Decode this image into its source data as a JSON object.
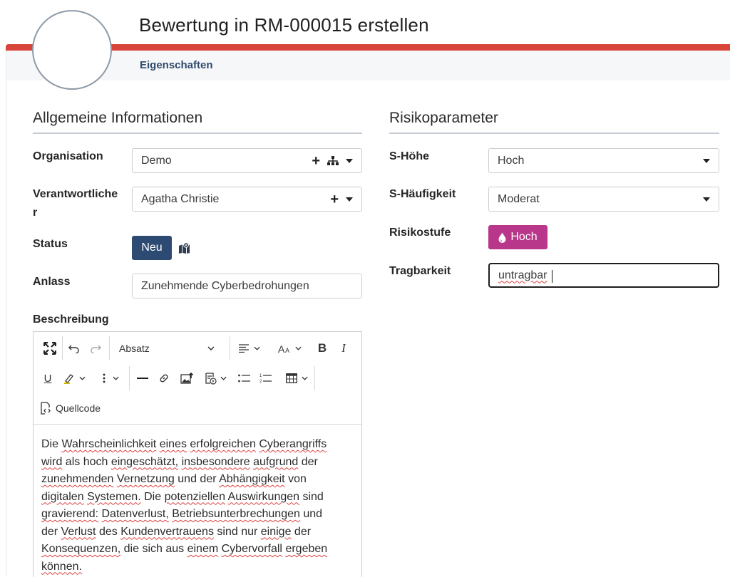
{
  "header": {
    "title": "Bewertung in RM-000015 erstellen",
    "tab_active": "Eigenschaften",
    "accent_color": "#d9443a"
  },
  "left": {
    "section_title": "Allgemeine Informationen",
    "organisation": {
      "label": "Organisation",
      "value": "Demo",
      "icons": [
        "plus-icon",
        "sitemap-icon",
        "caret-down-icon"
      ]
    },
    "verantwortlicher": {
      "label_line1": "Verantwortliche",
      "label_line2": "r",
      "value": "Agatha Christie",
      "icons": [
        "plus-icon",
        "caret-down-icon"
      ]
    },
    "status": {
      "label": "Status",
      "badge": "Neu",
      "badge_color": "#2d4b72",
      "icon": "map-icon"
    },
    "anlass": {
      "label": "Anlass",
      "value": "Zunehmende Cyberbedrohungen"
    },
    "beschreibung": {
      "label": "Beschreibung",
      "toolbar": {
        "heading_select": "Absatz",
        "source_label": "Quellcode",
        "icons": [
          "fullscreen-icon",
          "undo-icon",
          "redo-icon",
          "align-icon",
          "font-size-icon",
          "bold-icon",
          "italic-icon",
          "underline-icon",
          "highlight-icon",
          "more-icon",
          "horizontal-line-icon",
          "link-icon",
          "image-upload-icon",
          "insert-template-icon",
          "bulleted-list-icon",
          "numbered-list-icon",
          "table-icon",
          "source-code-icon"
        ]
      },
      "text_lines": [
        [
          {
            "t": "Die "
          },
          {
            "t": "Wahrscheinlichkeit",
            "s": true
          },
          {
            "t": " "
          },
          {
            "t": "eines",
            "s": true
          },
          {
            "t": " "
          },
          {
            "t": "erfolgreichen",
            "s": true
          },
          {
            "t": " "
          },
          {
            "t": "Cyberangriffs",
            "s": true
          }
        ],
        [
          {
            "t": "wird",
            "s": true
          },
          {
            "t": " als hoch "
          },
          {
            "t": "eingeschätzt,",
            "s": true
          },
          {
            "t": " "
          },
          {
            "t": "insbesondere",
            "s": true
          },
          {
            "t": " "
          },
          {
            "t": "aufgrund",
            "s": true
          },
          {
            "t": " der"
          }
        ],
        [
          {
            "t": "zunehmenden",
            "s": true
          },
          {
            "t": " "
          },
          {
            "t": "Vernetzung",
            "s": true
          },
          {
            "t": " und der "
          },
          {
            "t": "Abhängigkeit",
            "s": true
          },
          {
            "t": " von"
          }
        ],
        [
          {
            "t": "digitalen",
            "s": true
          },
          {
            "t": " "
          },
          {
            "t": "Systemen.",
            "s": true
          },
          {
            "t": " Die "
          },
          {
            "t": "potenziellen",
            "s": true
          },
          {
            "t": " "
          },
          {
            "t": "Auswirkungen",
            "s": true
          },
          {
            "t": " sind"
          }
        ],
        [
          {
            "t": "gravierend:",
            "s": true
          },
          {
            "t": " "
          },
          {
            "t": "Datenverlust,",
            "s": true
          },
          {
            "t": " "
          },
          {
            "t": "Betriebsunterbrechungen",
            "s": true
          },
          {
            "t": " und"
          }
        ],
        [
          {
            "t": "der "
          },
          {
            "t": "Verlust",
            "s": true
          },
          {
            "t": " des "
          },
          {
            "t": "Kundenvertrauens",
            "s": true
          },
          {
            "t": " sind nur "
          },
          {
            "t": "einige",
            "s": true
          },
          {
            "t": " der"
          }
        ],
        [
          {
            "t": "Konsequenzen,",
            "s": true
          },
          {
            "t": " die sich aus "
          },
          {
            "t": "einem",
            "s": true
          },
          {
            "t": " "
          },
          {
            "t": "Cybervorfall",
            "s": true
          },
          {
            "t": " "
          },
          {
            "t": "ergeben",
            "s": true
          }
        ],
        [
          {
            "t": "können.",
            "s": true
          }
        ]
      ]
    }
  },
  "right": {
    "section_title": "Risikoparameter",
    "s_hoehe": {
      "label": "S-Höhe",
      "value": "Hoch"
    },
    "s_haeufigkeit": {
      "label": "S-Häufigkeit",
      "value": "Moderat"
    },
    "risikostufe": {
      "label": "Risikostufe",
      "badge": "Hoch",
      "badge_color": "#b8378a",
      "icon": "drop-icon"
    },
    "tragbarkeit": {
      "label": "Tragbarkeit",
      "value": "untragbar"
    }
  }
}
